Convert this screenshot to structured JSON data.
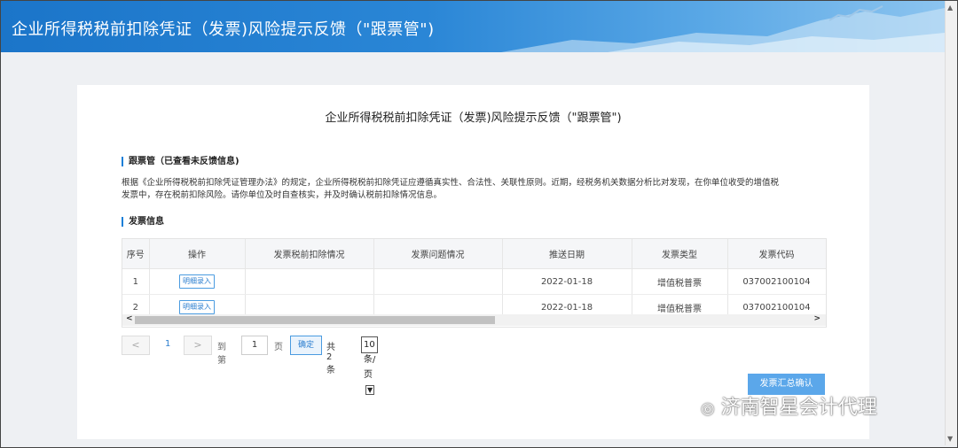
{
  "header": {
    "title": "企业所得税税前扣除凭证（发票)风险提示反馈（\"跟票管\")"
  },
  "card": {
    "title": "企业所得税税前扣除凭证（发票)风险提示反馈（\"跟票管\")",
    "section1": "跟票管（已查看未反馈信息)",
    "description_line1": "根据《企业所得税税前扣除凭证管理办法》的规定，企业所得税税前扣除凭证应遵循真实性、合法性、关联性原则。近期，经税务机关数据分析比对发现，在你单位收受的增值税",
    "description_line2": "发票中，存在税前扣除风险。请你单位及时自查核实，并及时确认税前扣除情况信息。",
    "section2": "发票信息"
  },
  "table": {
    "columns": [
      "序号",
      "操作",
      "发票税前扣除情况",
      "发票问题情况",
      "推送日期",
      "发票类型",
      "发票代码"
    ],
    "rows": [
      {
        "index": "1",
        "action": "明细录入",
        "deduction": "",
        "issue": "",
        "date": "2022-01-18",
        "type": "增值税普票",
        "code": "037002100104"
      },
      {
        "index": "2",
        "action": "明细录入",
        "deduction": "",
        "issue": "",
        "date": "2022-01-18",
        "type": "增值税普票",
        "code": "037002100104"
      }
    ]
  },
  "pager": {
    "prev": "<",
    "current_page": "1",
    "next": ">",
    "goto_label": "到第",
    "goto_value": "1",
    "page_label": "页",
    "confirm": "确定",
    "total": "共 2 条",
    "page_size": "10 条/页"
  },
  "summary_button": "发票汇总确认",
  "watermark": "济南智星会计代理"
}
